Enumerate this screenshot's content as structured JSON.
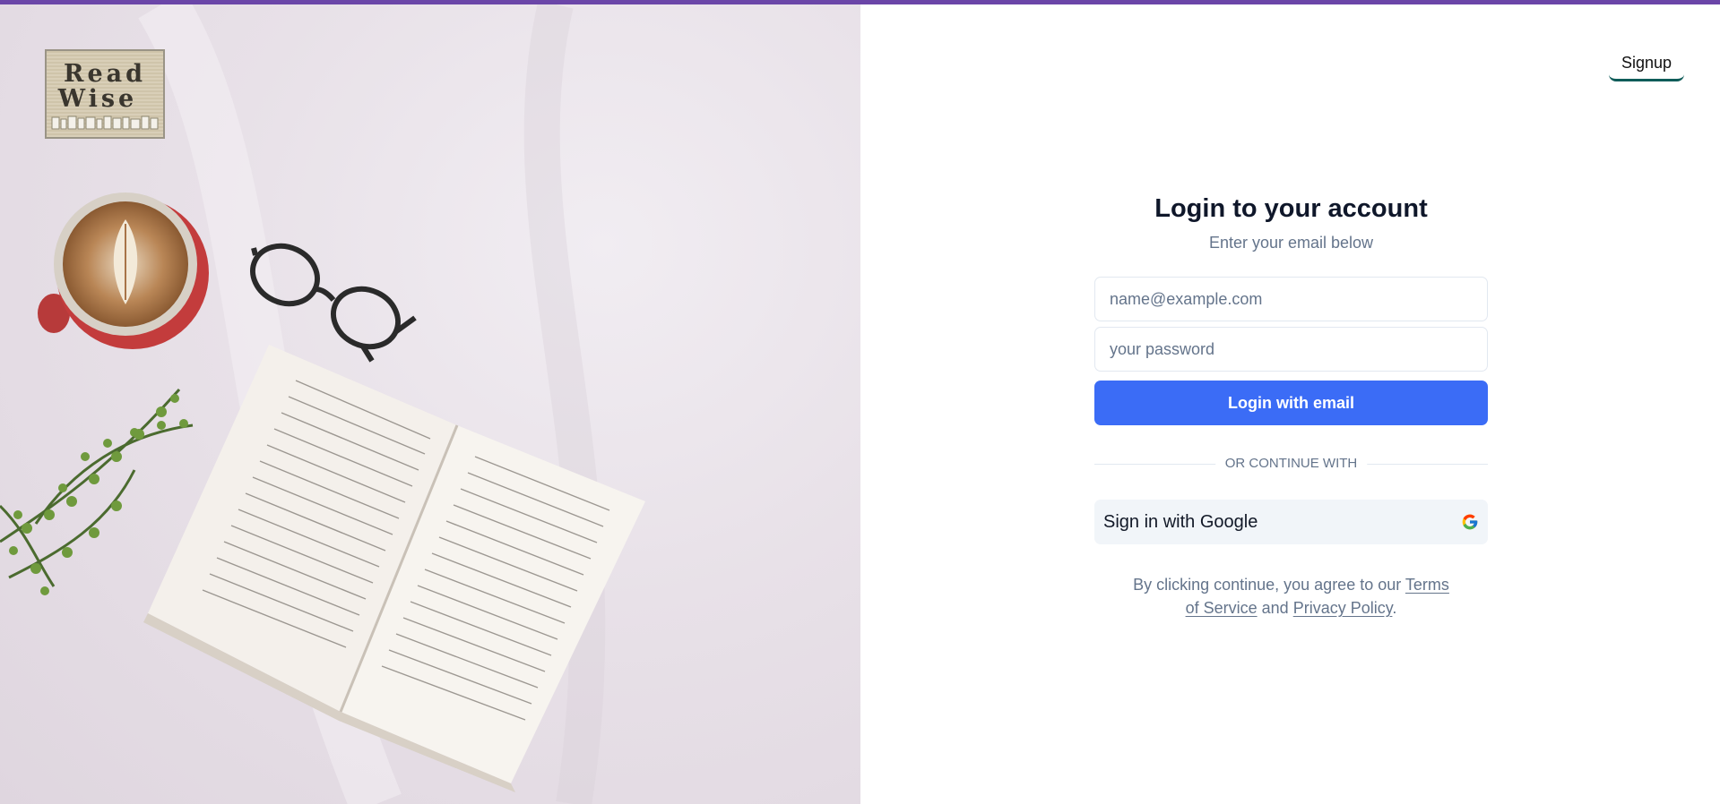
{
  "colors": {
    "top_bar": "#6b46a8",
    "primary_button": "#3b6cf6",
    "signup_underline": "#0f5c59",
    "muted_text": "#64748b"
  },
  "logo": {
    "line1": "Read",
    "line2": "Wise"
  },
  "header": {
    "signup_label": "Signup"
  },
  "auth": {
    "title": "Login to your account",
    "subtitle": "Enter your email below",
    "email_placeholder": "name@example.com",
    "email_value": "",
    "password_placeholder": "your password",
    "password_value": "",
    "login_button": "Login with email",
    "divider_text": "OR CONTINUE WITH",
    "google_button": "Sign in with Google",
    "google_icon": "google-icon"
  },
  "legal": {
    "prefix": "By clicking continue, you agree to our",
    "terms_link": "Terms of Service",
    "conjunction": "and",
    "privacy_link": "Privacy Policy",
    "suffix": "."
  }
}
